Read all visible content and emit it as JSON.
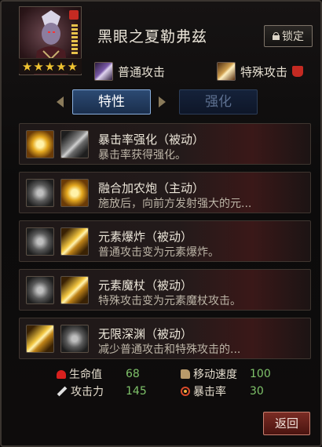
{
  "character": {
    "name": "黑眼之夏勒弗兹",
    "stars": "★★★★★",
    "lock_label": "锁定"
  },
  "attacks": {
    "normal_label": "普通攻击",
    "special_label": "特殊攻击"
  },
  "tabs": [
    {
      "label": "特性",
      "active": true
    },
    {
      "label": "强化",
      "active": false
    }
  ],
  "skills": [
    {
      "name": "暴击率强化（被动）",
      "desc": "暴击率获得强化。",
      "icon": "crosshair-icon"
    },
    {
      "name": "融合加农炮（主动）",
      "desc": "施放后，向前方发射强大的元...",
      "icon": "cannon-icon"
    },
    {
      "name": "元素爆炸（被动）",
      "desc": "普通攻击变为元素爆炸。",
      "icon": "blast-icon"
    },
    {
      "name": "元素魔杖（被动）",
      "desc": "特殊攻击变为元素魔杖攻击。",
      "icon": "wand-icon"
    },
    {
      "name": "无限深渊（被动）",
      "desc": "减少普通攻击和特殊攻击的...",
      "icon": "abyss-icon"
    }
  ],
  "stats": {
    "hp_label": "生命值",
    "hp_value": "68",
    "atk_label": "攻击力",
    "atk_value": "145",
    "speed_label": "移动速度",
    "speed_value": "100",
    "crit_label": "暴击率",
    "crit_value": "30"
  },
  "back_label": "返回",
  "colors": {
    "stat_value": "#7fc36a",
    "tab_active": "#2c4a73",
    "back_button": "#7a2c24"
  }
}
